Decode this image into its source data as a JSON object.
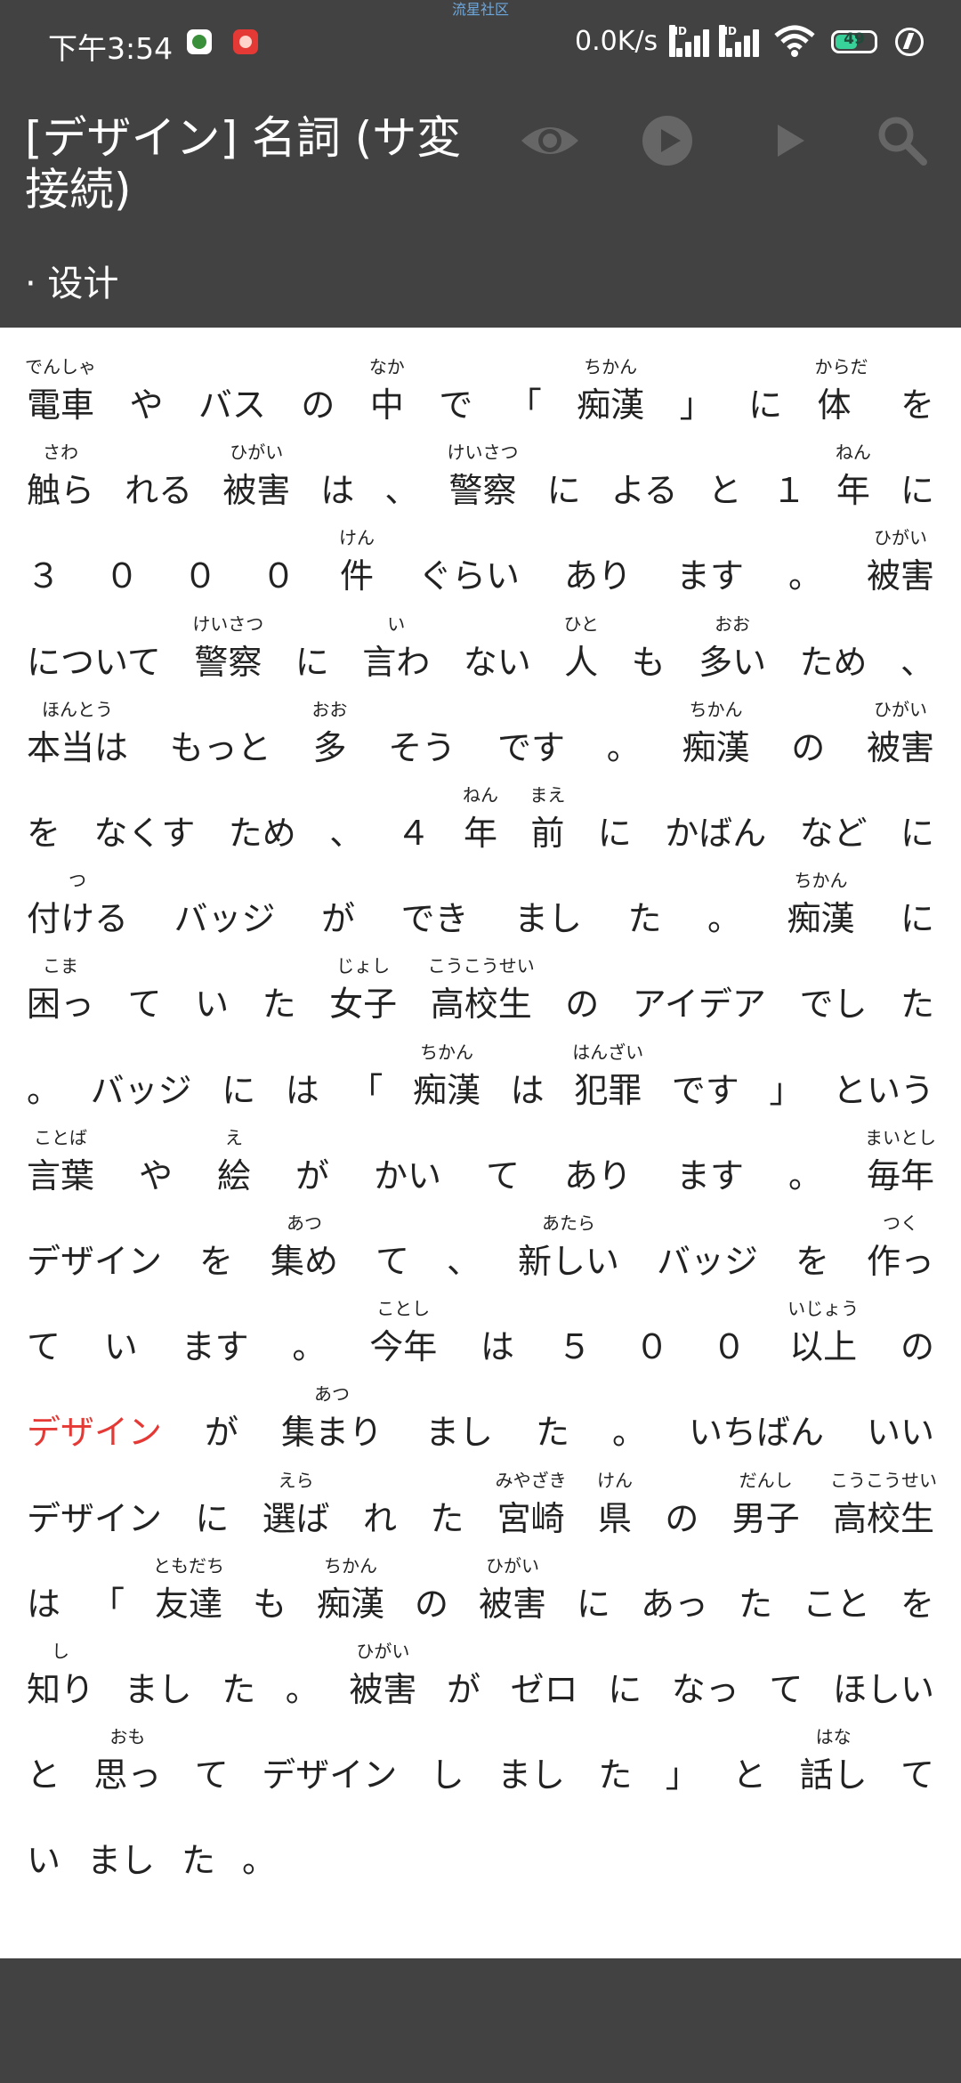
{
  "status_bar": {
    "time": "下午3:54",
    "watermark": "流星社区",
    "network_speed": "0.0K/s",
    "signal1_label": "HD",
    "signal2_label": "HD",
    "battery_level": "49"
  },
  "header": {
    "title": "[デザイン] 名詞 (サ変接続)",
    "subtitle": "· 设计"
  },
  "toolbar": {
    "icons": [
      "eye-icon",
      "play-circle-icon",
      "play-icon",
      "search-icon"
    ]
  },
  "colors": {
    "header_bg": "#424242",
    "highlight": "#e53935",
    "text": "#222222"
  },
  "article": {
    "lines": [
      [
        {
          "t": "電車",
          "r": "でんしゃ"
        },
        {
          "t": "や"
        },
        {
          "t": "バス"
        },
        {
          "t": "の"
        },
        {
          "t": "中",
          "r": "なか"
        },
        {
          "t": "で"
        },
        {
          "t": "「"
        },
        {
          "t": "痴漢",
          "r": "ちかん"
        },
        {
          "t": "」"
        },
        {
          "t": "に"
        },
        {
          "t": "体",
          "r": "からだ"
        },
        {
          "t": "を"
        }
      ],
      [
        {
          "t": "触ら",
          "r": "さわ"
        },
        {
          "t": "れる"
        },
        {
          "t": "被害",
          "r": "ひがい"
        },
        {
          "t": "は"
        },
        {
          "t": "、"
        },
        {
          "t": "警察",
          "r": "けいさつ"
        },
        {
          "t": "に"
        },
        {
          "t": "よる"
        },
        {
          "t": "と"
        },
        {
          "t": "１"
        },
        {
          "t": "年",
          "r": "ねん"
        },
        {
          "t": "に"
        }
      ],
      [
        {
          "t": "３"
        },
        {
          "t": "０"
        },
        {
          "t": "０"
        },
        {
          "t": "０"
        },
        {
          "t": "件",
          "r": "けん"
        },
        {
          "t": "ぐらい"
        },
        {
          "t": "あり"
        },
        {
          "t": "ます"
        },
        {
          "t": "。"
        },
        {
          "t": "被害",
          "r": "ひがい"
        }
      ],
      [
        {
          "t": "について"
        },
        {
          "t": "警察",
          "r": "けいさつ"
        },
        {
          "t": "に"
        },
        {
          "t": "言わ",
          "r": "い"
        },
        {
          "t": "ない"
        },
        {
          "t": "人",
          "r": "ひと"
        },
        {
          "t": "も"
        },
        {
          "t": "多い",
          "r": "おお"
        },
        {
          "t": "ため"
        },
        {
          "t": "、"
        }
      ],
      [
        {
          "t": "本当は",
          "r": "ほんとう"
        },
        {
          "t": "もっと"
        },
        {
          "t": "多",
          "r": "おお"
        },
        {
          "t": "そう"
        },
        {
          "t": "です"
        },
        {
          "t": "。"
        },
        {
          "t": "痴漢",
          "r": "ちかん"
        },
        {
          "t": "の"
        },
        {
          "t": "被害",
          "r": "ひがい"
        }
      ],
      [
        {
          "t": "を"
        },
        {
          "t": "なくす"
        },
        {
          "t": "ため"
        },
        {
          "t": "、"
        },
        {
          "t": "４"
        },
        {
          "t": "年",
          "r": "ねん"
        },
        {
          "t": "前",
          "r": "まえ"
        },
        {
          "t": "に"
        },
        {
          "t": "かばん"
        },
        {
          "t": "など"
        },
        {
          "t": "に"
        }
      ],
      [
        {
          "t": "付ける",
          "r": "つ"
        },
        {
          "t": "バッジ"
        },
        {
          "t": "が"
        },
        {
          "t": "でき"
        },
        {
          "t": "まし"
        },
        {
          "t": "た"
        },
        {
          "t": "。"
        },
        {
          "t": "痴漢",
          "r": "ちかん"
        },
        {
          "t": "に"
        }
      ],
      [
        {
          "t": "困っ",
          "r": "こま"
        },
        {
          "t": "て"
        },
        {
          "t": "い"
        },
        {
          "t": "た"
        },
        {
          "t": "女子",
          "r": "じょし"
        },
        {
          "t": "高校生",
          "r": "こうこうせい"
        },
        {
          "t": "の"
        },
        {
          "t": "アイデア"
        },
        {
          "t": "でし"
        },
        {
          "t": "た"
        }
      ],
      [
        {
          "t": "。"
        },
        {
          "t": "バッジ"
        },
        {
          "t": "に"
        },
        {
          "t": "は"
        },
        {
          "t": "「"
        },
        {
          "t": "痴漢",
          "r": "ちかん"
        },
        {
          "t": "は"
        },
        {
          "t": "犯罪",
          "r": "はんざい"
        },
        {
          "t": "です"
        },
        {
          "t": "」"
        },
        {
          "t": "という"
        }
      ],
      [
        {
          "t": "言葉",
          "r": "ことば"
        },
        {
          "t": "や"
        },
        {
          "t": "絵",
          "r": "え"
        },
        {
          "t": "が"
        },
        {
          "t": "かい"
        },
        {
          "t": "て"
        },
        {
          "t": "あり"
        },
        {
          "t": "ます"
        },
        {
          "t": "。"
        },
        {
          "t": "毎年",
          "r": "まいとし"
        }
      ],
      [
        {
          "t": "デザイン"
        },
        {
          "t": "を"
        },
        {
          "t": "集め",
          "r": "あつ"
        },
        {
          "t": "て"
        },
        {
          "t": "、"
        },
        {
          "t": "新しい",
          "r": "あたら"
        },
        {
          "t": "バッジ"
        },
        {
          "t": "を"
        },
        {
          "t": "作っ",
          "r": "つく"
        }
      ],
      [
        {
          "t": "て"
        },
        {
          "t": "い"
        },
        {
          "t": "ます"
        },
        {
          "t": "。"
        },
        {
          "t": "今年",
          "r": "ことし"
        },
        {
          "t": "は"
        },
        {
          "t": "５"
        },
        {
          "t": "０"
        },
        {
          "t": "０"
        },
        {
          "t": "以上",
          "r": "いじょう"
        },
        {
          "t": "の"
        }
      ],
      [
        {
          "t": "デザイン",
          "h": true
        },
        {
          "t": "が"
        },
        {
          "t": "集まり",
          "r": "あつ"
        },
        {
          "t": "まし"
        },
        {
          "t": "た"
        },
        {
          "t": "。"
        },
        {
          "t": "いちばん"
        },
        {
          "t": "いい"
        }
      ],
      [
        {
          "t": "デザイン"
        },
        {
          "t": "に"
        },
        {
          "t": "選ば",
          "r": "えら"
        },
        {
          "t": "れ"
        },
        {
          "t": "た"
        },
        {
          "t": "宮崎",
          "r": "みやざき"
        },
        {
          "t": "県",
          "r": "けん"
        },
        {
          "t": "の"
        },
        {
          "t": "男子",
          "r": "だんし"
        },
        {
          "t": "高校生",
          "r": "こうこうせい"
        }
      ],
      [
        {
          "t": "は"
        },
        {
          "t": "「"
        },
        {
          "t": "友達",
          "r": "ともだち"
        },
        {
          "t": "も"
        },
        {
          "t": "痴漢",
          "r": "ちかん"
        },
        {
          "t": "の"
        },
        {
          "t": "被害",
          "r": "ひがい"
        },
        {
          "t": "に"
        },
        {
          "t": "あっ"
        },
        {
          "t": "た"
        },
        {
          "t": "こと"
        },
        {
          "t": "を"
        }
      ],
      [
        {
          "t": "知り",
          "r": "し"
        },
        {
          "t": "まし"
        },
        {
          "t": "た"
        },
        {
          "t": "。"
        },
        {
          "t": "被害",
          "r": "ひがい"
        },
        {
          "t": "が"
        },
        {
          "t": "ゼロ"
        },
        {
          "t": "に"
        },
        {
          "t": "なっ"
        },
        {
          "t": "て"
        },
        {
          "t": "ほしい"
        }
      ],
      [
        {
          "t": "と"
        },
        {
          "t": "思っ",
          "r": "おも"
        },
        {
          "t": "て"
        },
        {
          "t": "デザイン"
        },
        {
          "t": "し"
        },
        {
          "t": "まし"
        },
        {
          "t": "た"
        },
        {
          "t": "」"
        },
        {
          "t": "と"
        },
        {
          "t": "話し",
          "r": "はな"
        },
        {
          "t": "て"
        }
      ],
      [
        {
          "t": "い"
        },
        {
          "t": "まし"
        },
        {
          "t": "た"
        },
        {
          "t": "。"
        }
      ]
    ]
  }
}
